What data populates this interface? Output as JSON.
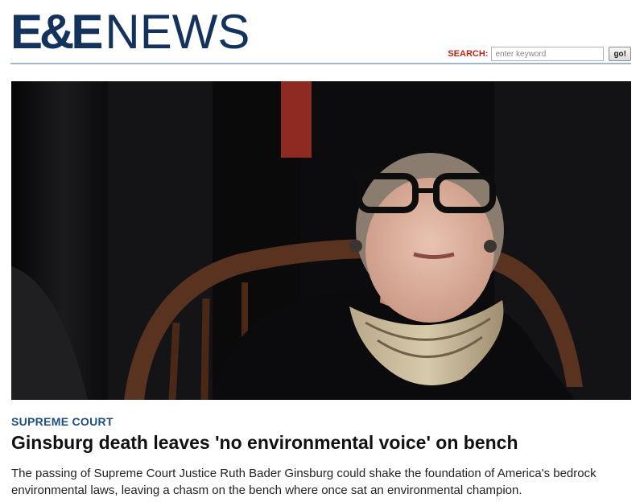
{
  "header": {
    "logo_brand": "E&E",
    "logo_news": "NEWS",
    "search_label": "SEARCH:",
    "search_placeholder": "enter keyword",
    "search_button": "go!"
  },
  "article": {
    "kicker": "SUPREME COURT",
    "headline": "Ginsburg death leaves 'no environmental voice' on bench",
    "summary": "The passing of Supreme Court Justice Ruth Bader Ginsburg could shake the foundation of America's bedrock environmental laws, leaving a chasm on the bench where once sat an environmental champion."
  },
  "colors": {
    "brand_navy": "#13325c",
    "search_label_red": "#b3261e",
    "kicker_blue": "#1d4e7e",
    "rule_blue": "#9fb6cc"
  }
}
